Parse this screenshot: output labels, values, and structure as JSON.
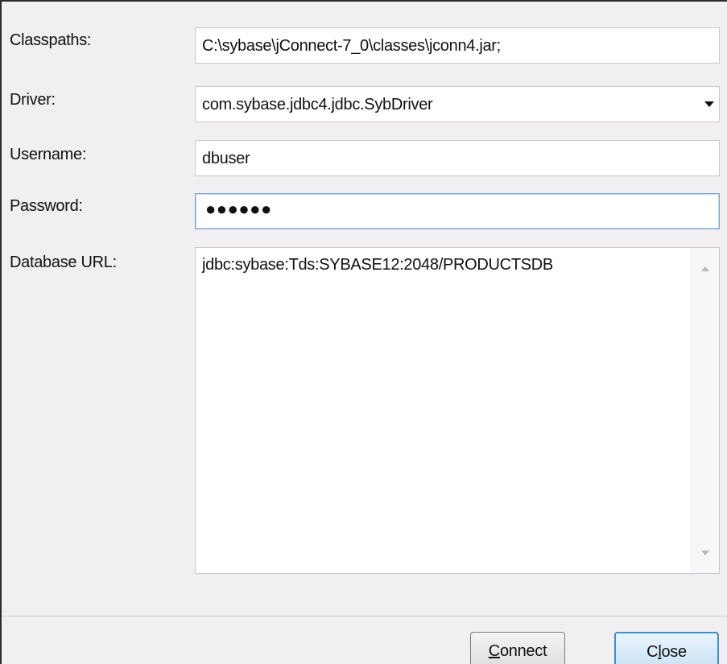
{
  "form": {
    "classpaths_label": "Classpaths:",
    "classpaths_value": "C:\\sybase\\jConnect-7_0\\classes\\jconn4.jar;",
    "driver_label": "Driver:",
    "driver_value": "com.sybase.jdbc4.jdbc.SybDriver",
    "username_label": "Username:",
    "username_value": "dbuser",
    "password_label": "Password:",
    "password_masked": "●●●●●●",
    "url_label": "Database URL:",
    "url_value": "jdbc:sybase:Tds:SYBASE12:2048/PRODUCTSDB"
  },
  "buttons": {
    "connect_mnemonic": "C",
    "connect_rest": "onnect",
    "close_pre": "C",
    "close_mnemonic": "l",
    "close_rest": "ose"
  },
  "icons": {
    "driver_dropdown": "chevron-down-icon",
    "scroll_up": "scroll-up-arrow-icon",
    "scroll_down": "scroll-down-arrow-icon"
  },
  "colors": {
    "dialog_bg": "#f1eff1",
    "focus_border": "#7aa3cf",
    "close_button_border": "#3c8fd2"
  }
}
